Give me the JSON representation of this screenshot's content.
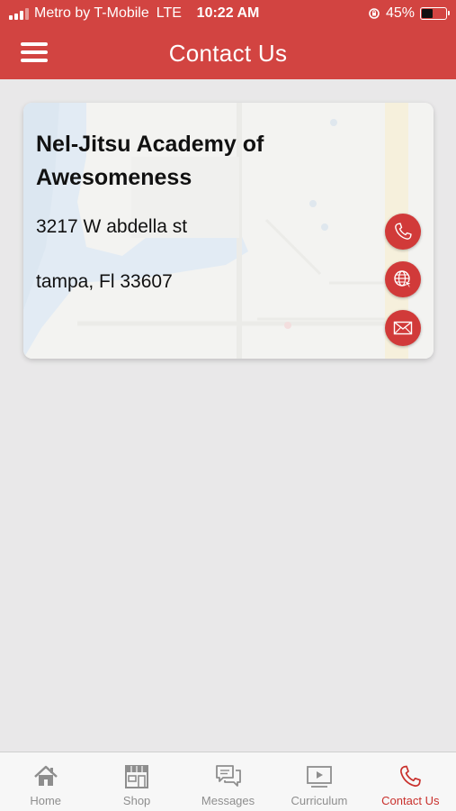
{
  "status_bar": {
    "carrier": "Metro by T-Mobile",
    "network": "LTE",
    "time": "10:22 AM",
    "battery": "45%",
    "battery_level": 0.45
  },
  "nav": {
    "title": "Contact Us"
  },
  "card": {
    "name": "Nel-Jitsu Academy of Awesomeness",
    "address_line1": "3217 W abdella st",
    "address_line2": "tampa, Fl 33607"
  },
  "tabs": [
    {
      "label": "Home",
      "icon": "home-icon"
    },
    {
      "label": "Shop",
      "icon": "shop-icon"
    },
    {
      "label": "Messages",
      "icon": "messages-icon"
    },
    {
      "label": "Curriculum",
      "icon": "curriculum-icon"
    },
    {
      "label": "Contact Us",
      "icon": "phone-icon",
      "active": true
    }
  ],
  "colors": {
    "brand": "#d24441",
    "fab": "#d13a39",
    "active_tab": "#c9302c",
    "inactive_tab": "#8e8e8e",
    "background": "#e9e8e9"
  }
}
